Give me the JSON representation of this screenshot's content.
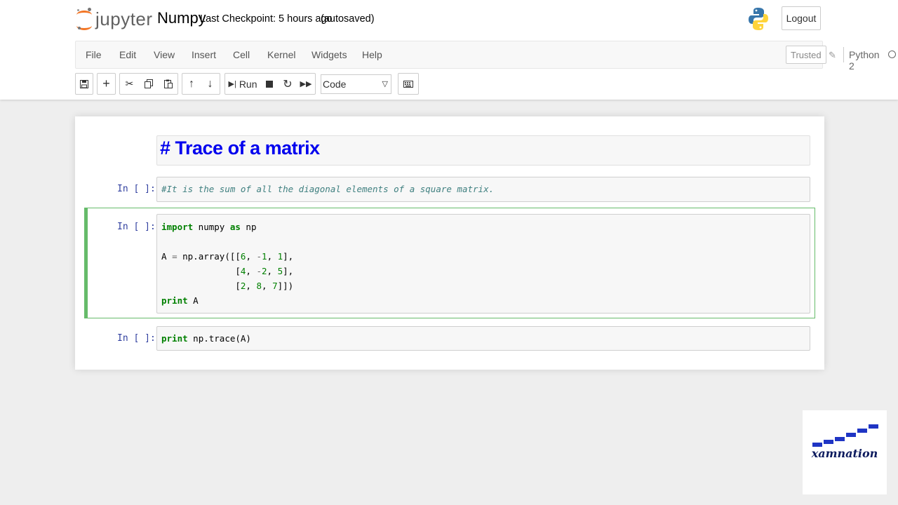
{
  "app": {
    "logo_text": "jupyter",
    "notebook_name": "Numpy",
    "checkpoint": "Last Checkpoint: 5 hours ago",
    "autosave": "(autosaved)",
    "logout_label": "Logout"
  },
  "menu": {
    "items": [
      "File",
      "Edit",
      "View",
      "Insert",
      "Cell",
      "Kernel",
      "Widgets",
      "Help"
    ],
    "trusted": "Trusted",
    "kernel": "Python 2"
  },
  "toolbar": {
    "run_label": "Run",
    "cell_type": "Code"
  },
  "cells": {
    "markdown_title": "# Trace of a matrix",
    "prompt": "In [ ]:",
    "comment": "#It is the sum of all the diagonal elements of a square matrix.",
    "code1": {
      "line1_kw1": "import",
      "line1_rest1": " numpy ",
      "line1_kw2": "as",
      "line1_rest2": " np",
      "line2_a": "A ",
      "line2_eq": "=",
      "line2_call": " np.array([[",
      "r1": [
        "6",
        "-1",
        "1"
      ],
      "r2": [
        "4",
        "-2",
        "5"
      ],
      "r3": [
        "2",
        "8",
        "7"
      ],
      "line3_kw": "print",
      "line3_rest": " A"
    },
    "code2": {
      "kw": "print",
      "rest": " np.trace(A)"
    }
  },
  "watermark": {
    "text": "xamnation"
  },
  "colors": {
    "selected_border": "#66bb6a",
    "prompt": "#303f9f",
    "title": "#0000ee"
  }
}
